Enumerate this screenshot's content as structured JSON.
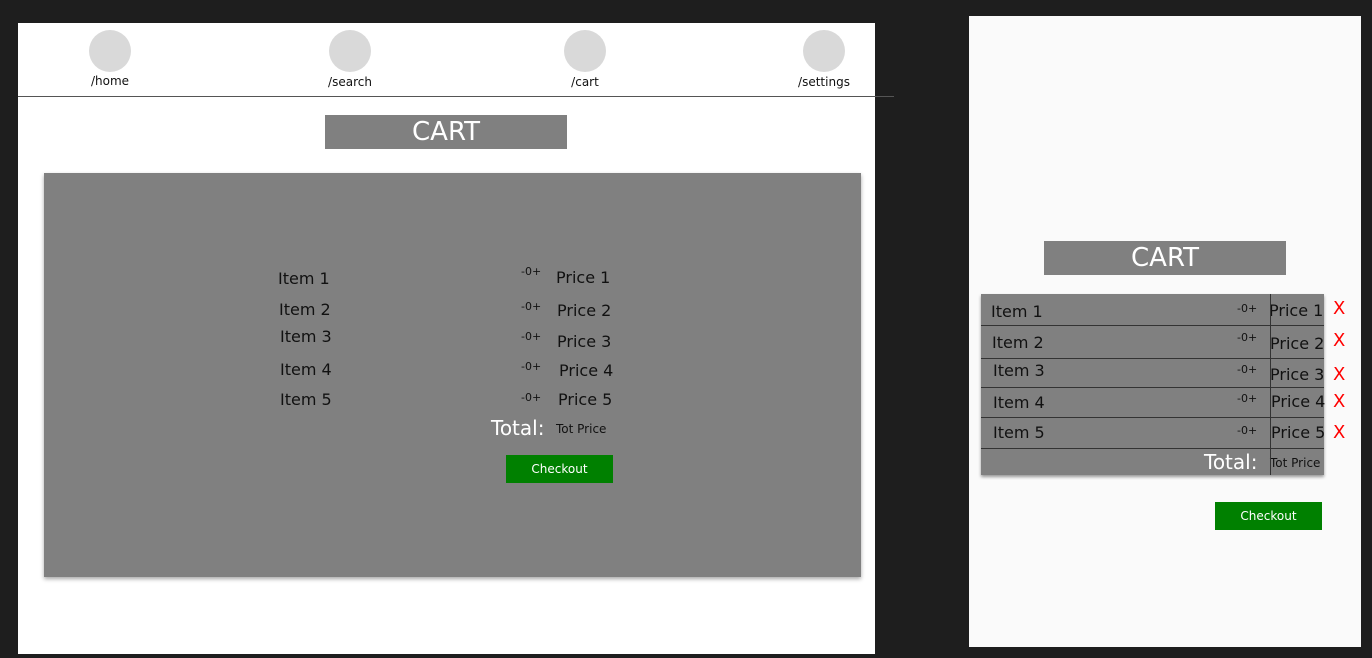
{
  "nav": {
    "items": [
      {
        "label": "/home"
      },
      {
        "label": "/search"
      },
      {
        "label": "/cart"
      },
      {
        "label": "/settings"
      }
    ]
  },
  "cart": {
    "title": "CART",
    "items": [
      {
        "name": "Item 1",
        "qty": "-0+",
        "price": "Price 1"
      },
      {
        "name": "Item 2",
        "qty": "-0+",
        "price": "Price 2"
      },
      {
        "name": "Item 3",
        "qty": "-0+",
        "price": "Price 3"
      },
      {
        "name": "Item 4",
        "qty": "-0+",
        "price": "Price 4"
      },
      {
        "name": "Item 5",
        "qty": "-0+",
        "price": "Price 5"
      }
    ],
    "total_label": "Total:",
    "total_value": "Tot Price",
    "checkout_label": "Checkout",
    "remove_label": "X"
  },
  "colors": {
    "panel": "#808080",
    "checkout": "#008000",
    "remove": "#ff0000"
  }
}
